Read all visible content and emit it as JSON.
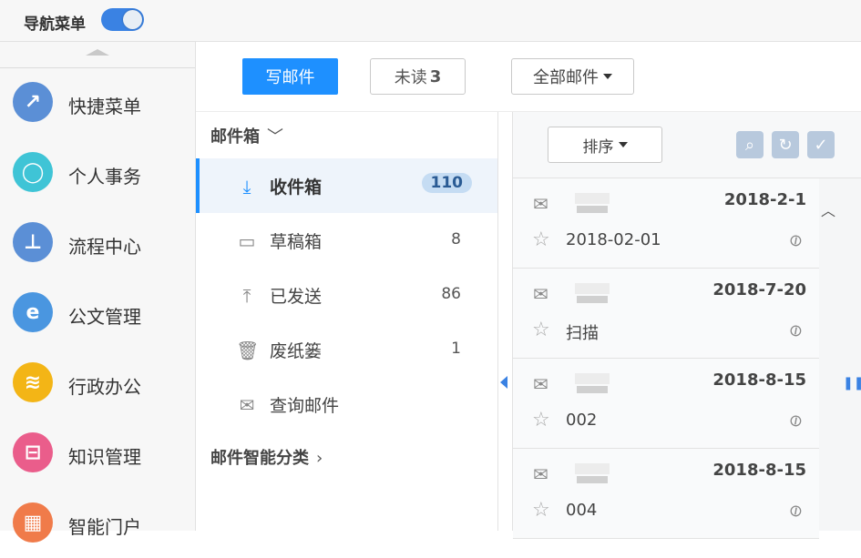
{
  "topbar": {
    "title": "导航菜单"
  },
  "nav": {
    "items": [
      {
        "label": "快捷菜单",
        "icon": "quick-menu-icon",
        "color": "#5b8fd6",
        "glyph": "↗"
      },
      {
        "label": "个人事务",
        "icon": "person-icon",
        "color": "#3fc4d6",
        "glyph": "◯"
      },
      {
        "label": "流程中心",
        "icon": "stamp-icon",
        "color": "#5b8fd6",
        "glyph": "⊥"
      },
      {
        "label": "公文管理",
        "icon": "ie-icon",
        "color": "#4a96e0",
        "glyph": "e"
      },
      {
        "label": "行政办公",
        "icon": "layers-icon",
        "color": "#f3b516",
        "glyph": "≋"
      },
      {
        "label": "知识管理",
        "icon": "book-icon",
        "color": "#ea5d8b",
        "glyph": "⊟"
      },
      {
        "label": "智能门户",
        "icon": "building-icon",
        "color": "#f07b4a",
        "glyph": "▦"
      }
    ]
  },
  "toolbar": {
    "write_label": "写邮件",
    "unread_label": "未读",
    "unread_count": "3",
    "all_label": "全部邮件"
  },
  "mailbox": {
    "section_title": "邮件箱",
    "section_chevron": "﹀",
    "folders": [
      {
        "label": "收件箱",
        "count": "110",
        "icon": "inbox-download-icon",
        "glyph": "⤓"
      },
      {
        "label": "草稿箱",
        "count": "8",
        "icon": "drafts-icon",
        "glyph": "▭"
      },
      {
        "label": "已发送",
        "count": "86",
        "icon": "sent-upload-icon",
        "glyph": "⤒"
      },
      {
        "label": "废纸篓",
        "count": "1",
        "icon": "trash-icon",
        "glyph": "🗑"
      },
      {
        "label": "查询邮件",
        "count": "",
        "icon": "search-mail-icon",
        "glyph": "✉"
      }
    ],
    "smart_title": "邮件智能分类",
    "smart_chevron": "›"
  },
  "maillist": {
    "sort_label": "排序",
    "mails": [
      {
        "date": "2018-2-1",
        "subject": "2018-02-01"
      },
      {
        "date": "2018-7-20",
        "subject": "扫描"
      },
      {
        "date": "2018-8-15",
        "subject": "002"
      },
      {
        "date": "2018-8-15",
        "subject": "004"
      }
    ]
  }
}
